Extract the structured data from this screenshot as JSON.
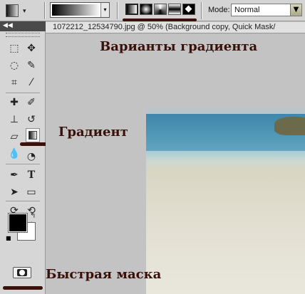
{
  "options_bar": {
    "mode_label": "Mode:",
    "mode_value": "Normal",
    "gradient_types": [
      "linear",
      "radial",
      "angle",
      "reflected",
      "diamond"
    ]
  },
  "document": {
    "title": "1072212_12534790.jpg @ 50% (Background copy, Quick Mask/"
  },
  "toolbox": {
    "collapse_glyph": "◀◀",
    "tools": [
      "marquee",
      "move",
      "lasso",
      "quick-selection",
      "crop",
      "eyedropper",
      "healing-brush",
      "brush",
      "clone-stamp",
      "history-brush",
      "eraser",
      "gradient",
      "blur",
      "dodge",
      "pen",
      "type",
      "path-selection",
      "rectangle",
      "3d-rotate",
      "3d-orbit",
      "hand",
      "zoom"
    ],
    "foreground_color": "#000000",
    "background_color": "#ffffff"
  },
  "annotations": {
    "variants": "Варианты градиента",
    "gradient": "Градиент",
    "quick_mask": "Быстрая маска",
    "color": "#3a1008"
  }
}
